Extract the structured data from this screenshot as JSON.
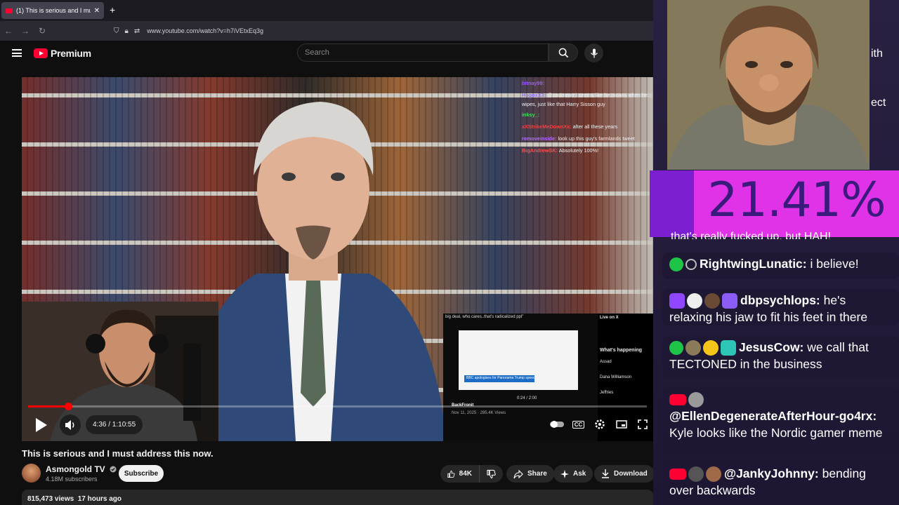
{
  "browser": {
    "tab_title": "(1) This is serious and I must ad",
    "tab_close": "✕",
    "new_tab": "+",
    "url": "www.youtube.com/watch?v=h7iVEtxEq3g"
  },
  "yt": {
    "brand": "Premium",
    "search_placeholder": "Search"
  },
  "overlay_chat": [
    {
      "user": "bitnay99:",
      "msg": "",
      "color": "#9b59ff"
    },
    {
      "user": "HugoxX3:",
      "msg": "@zackrawrr i seems like he moans when he wipes, just like that Harry Sisson guy",
      "color": "#8a6bff"
    },
    {
      "user": "inksy_:",
      "msg": "",
      "color": "#4cd964"
    },
    {
      "user": "xXStrikeMeDownXx:",
      "msg": "after all these years",
      "color": "#ff3b3b"
    },
    {
      "user": "removeinside:",
      "msg": "look up this guy's farmlands tweet",
      "color": "#b36bff"
    },
    {
      "user": "BigAndrewSK:",
      "msg": "Absolutely 100%!",
      "color": "#ff4d4d"
    }
  ],
  "clip": {
    "caption": "big deal, who cares..that's radicalized ppl\"",
    "right_header": "Live on X",
    "headline": "BBC apologises for Panorama Trump speech edit",
    "whats_happening": "What's happening",
    "trends": [
      "Assad",
      "Dana Williamson",
      "Jeffries"
    ],
    "time": "0:24 / 2:00",
    "author": "BackFronit",
    "views_line": "Nov 11, 2025 · 285.4K Views"
  },
  "player": {
    "current": "4:36",
    "duration": "1:10:55",
    "time_label": "4:36 / 1:10:55",
    "progress_fraction": 0.065,
    "cc_label": "CC"
  },
  "video": {
    "title": "This is serious and I must address this now.",
    "channel": "Asmongold TV",
    "subscribers": "4.18M subscribers",
    "subscribe_label": "Subscribe",
    "likes": "84K",
    "share": "Share",
    "ask": "Ask",
    "download": "Download",
    "views": "815,473 views",
    "age": "17 hours ago"
  },
  "stream": {
    "percent": "21.41%",
    "percent_value": 21.41,
    "partial_right_1": "ith",
    "partial_right_2": "ect",
    "cutoff_line": "that's really fucked up, but HAH!",
    "messages": [
      {
        "user": "RightwingLunatic:",
        "text": "i believe!"
      },
      {
        "user": "dbpsychlops:",
        "text": "he's relaxing his jaw to fit his feet in there"
      },
      {
        "user": "JesusCow:",
        "text": "we call that TECTONED in the business"
      },
      {
        "user": "@EllenDegenerateAfterHour-go4rx:",
        "text": "Kyle looks like the Nordic gamer meme"
      },
      {
        "user": "@JankyJohnny:",
        "text": "bending over backwards"
      }
    ]
  },
  "colors": {
    "yt_red": "#ff0033",
    "panel_purple": "#7b1fd0",
    "percent_magenta": "#e033e8"
  }
}
